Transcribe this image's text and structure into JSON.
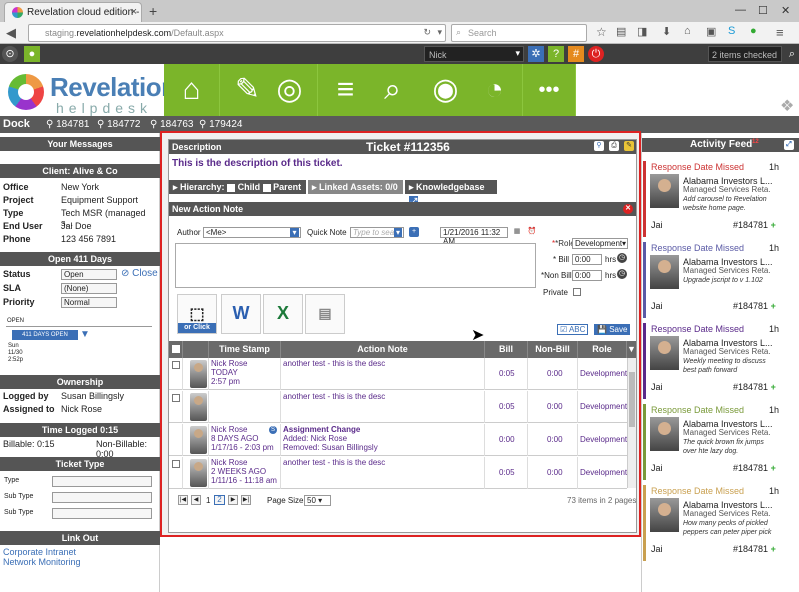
{
  "browser": {
    "tab_title": "Revelation cloud edition - ...",
    "url_prefix": "staging.",
    "url_domain": "revelationhelpdesk.com",
    "url_path": "/Default.aspx",
    "search_placeholder": "Search"
  },
  "appbar": {
    "user": "Nick",
    "checked_label": "2 items checked"
  },
  "logo": {
    "title": "Revelation",
    "subtitle": "helpdesk"
  },
  "dock": {
    "label": "Dock",
    "items": [
      "184781",
      "184772",
      "184763",
      "179424"
    ]
  },
  "left": {
    "messages_header": "Your Messages",
    "client_header": "Client: Alive & Co",
    "client_fields": [
      {
        "label": "Office",
        "value": "New York"
      },
      {
        "label": "Project",
        "value": "Equipment Support"
      },
      {
        "label": "Type",
        "value": "Tech MSR (managed s..."
      },
      {
        "label": "End User",
        "value": "Jal Doe"
      },
      {
        "label": "Phone",
        "value": "123 456 7891"
      }
    ],
    "open_header": "Open 411 Days",
    "status_label": "Status",
    "status_value": "Open",
    "close_label": "Close",
    "sla_label": "SLA",
    "sla_value": "(None)",
    "priority_label": "Priority",
    "priority_value": "Normal",
    "timeline_open": "OPEN",
    "timeline_days": "411 DAYS OPEN",
    "timeline_date1": "Sun",
    "timeline_date2": "11/30",
    "timeline_date3": "2:52p",
    "ownership_header": "Ownership",
    "logged_label": "Logged by",
    "logged_value": "Susan Billingsly",
    "assigned_label": "Assigned to",
    "assigned_value": "Nick Rose",
    "time_header": "Time Logged 0:15",
    "billable": "Billable: 0:15",
    "nonbillable": "Non-Billable: 0:00",
    "tickettype_header": "Ticket Type",
    "type_label": "Type",
    "subtype_label1": "Sub Type",
    "subtype_label2": "Sub Type",
    "linkout_header": "Link Out",
    "link1": "Corporate Intranet",
    "link2": "Network Monitoring"
  },
  "modal": {
    "description_label": "Description",
    "ticket_title": "Ticket #112356",
    "description_text": "This is the description of this ticket.",
    "hierarchy_label": "Hierarchy:",
    "child_label": "Child",
    "parent_label": "Parent",
    "linked_assets": "Linked Assets: 0/0",
    "knowledgebase": "Knowledgebase",
    "action_note_header": "New Action Note",
    "author_label": "Author",
    "author_value": "<Me>",
    "quick_note_label": "Quick Note",
    "quick_note_placeholder": "Type to sear",
    "date_value": "1/21/2016 11:32 AM",
    "role_label": "*Role",
    "role_value": "Development",
    "bill_label": "* Bill",
    "bill_value": "0:00",
    "nonbill_label": "*Non Bill",
    "nonbill_value": "0:00",
    "hrs": "hrs",
    "private_label": "Private",
    "orclick": "or Click",
    "abc_label": "ABC",
    "save_label": "Save",
    "grid_headers": [
      "Time Stamp",
      "Action Note",
      "Bill",
      "Non-Bill",
      "Role"
    ],
    "rows": [
      {
        "name": "Nick Rose",
        "when": "TODAY",
        "time": "2:57 pm",
        "note1": "another test - this is the desc",
        "note2": "",
        "note3": "",
        "bill": "0:05",
        "nonbill": "0:00",
        "role": "Development"
      },
      {
        "name": "",
        "when": "",
        "time": "",
        "note1": "another test - this is the desc",
        "note2": "",
        "note3": "",
        "bill": "0:05",
        "nonbill": "0:00",
        "role": "Development"
      },
      {
        "name": "Nick Rose",
        "when": "8 DAYS AGO",
        "time": "1/17/16 - 2:03 pm",
        "note1": "Assignment Change",
        "note2": "Added: Nick Rose",
        "note3": "Removed: Susan Billingsly",
        "bill": "0:00",
        "nonbill": "0:00",
        "role": "Development"
      },
      {
        "name": "Nick Rose",
        "when": "2 WEEKS AGO",
        "time": "1/11/16 - 11:18 am",
        "note1": "another test - this is the desc",
        "note2": "",
        "note3": "",
        "bill": "0:05",
        "nonbill": "0:00",
        "role": "Development"
      }
    ],
    "page_current": "2",
    "page_prev": "1",
    "page_size_label": "Page Size:",
    "page_size_value": "50",
    "items_summary": "73 items in 2 pages"
  },
  "right": {
    "header": "Activity Feed",
    "badge": "12",
    "items": [
      {
        "title": "Response Date Missed",
        "ago": "1h",
        "company": "Alabama Investors L...",
        "service": "Managed Services Reta...",
        "note": "Add carousel to Revelation website home page.",
        "user": "Jai",
        "ticket": "#184781",
        "color": "#c33"
      },
      {
        "title": "Response Date Missed",
        "ago": "1h",
        "company": "Alabama Investors L...",
        "service": "Managed Services Reta...",
        "note": "Upgrade jscript to v 1.102",
        "user": "Jai",
        "ticket": "#184781",
        "color": "#5a5aa5"
      },
      {
        "title": "Response Date Missed",
        "ago": "1h",
        "company": "Alabama Investors L...",
        "service": "Managed Services Reta...",
        "note": "Weekly meeting to discuss best path forward",
        "user": "Jai",
        "ticket": "#184781",
        "color": "#5a2a8a"
      },
      {
        "title": "Response Date Missed",
        "ago": "1h",
        "company": "Alabama Investors L...",
        "service": "Managed Services Reta...",
        "note": "The quick brown fix jumps over hte lazy dog.",
        "user": "Jai",
        "ticket": "#184781",
        "color": "#7a9a3a"
      },
      {
        "title": "Response Date Missed",
        "ago": "1h",
        "company": "Alabama Investors L...",
        "service": "Managed Services Reta...",
        "note": "How many pecks of pickled peppers can peter piper pick",
        "user": "Jai",
        "ticket": "#184781",
        "color": "#c9a050"
      }
    ]
  }
}
